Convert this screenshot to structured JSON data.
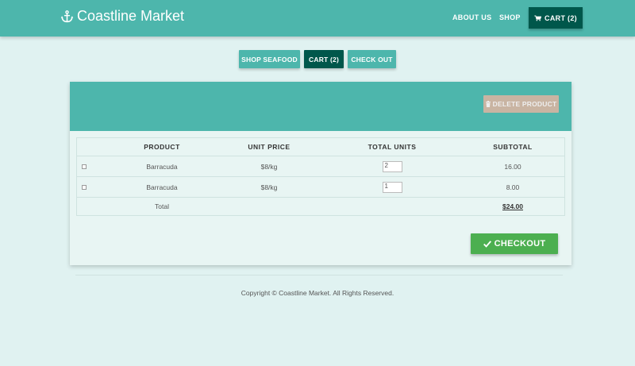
{
  "brand": {
    "name": "Coastline Market"
  },
  "nav": {
    "about": "ABOUT US",
    "shop": "SHOP",
    "cart": "CART (2)"
  },
  "tabs": {
    "shop_seafood": "SHOP SEAFOOD",
    "cart": "CART (2)",
    "check_out": "CHECK OUT"
  },
  "card": {
    "delete_label": "DELETE PRODUCT"
  },
  "table": {
    "headers": {
      "product": "PRODUCT",
      "unit_price": "UNIT PRICE",
      "total_units": "TOTAL UNITS",
      "subtotal": "SUBTOTAL"
    },
    "rows": [
      {
        "product": "Barracuda",
        "unit_price": "$8/kg",
        "units": "2",
        "subtotal": "16.00",
        "checked": false
      },
      {
        "product": "Barracuda",
        "unit_price": "$8/kg",
        "units": "1",
        "subtotal": "8.00",
        "checked": false
      }
    ],
    "total_label": "Total",
    "total_value": "$24.00"
  },
  "checkout": {
    "label": "CHECKOUT"
  },
  "footer": {
    "text": "Copyright © Coastline Market. All Rights Reserved."
  },
  "colors": {
    "primary": "#4db6ac",
    "dark": "#00574b",
    "background": "#e0f2f1",
    "checkout": "#4caf50",
    "delete_disabled": "#c9b4a2"
  },
  "icons": {
    "brand": "anchor-icon",
    "cart": "cart-icon",
    "delete": "trash-icon",
    "checkout": "check-icon"
  }
}
